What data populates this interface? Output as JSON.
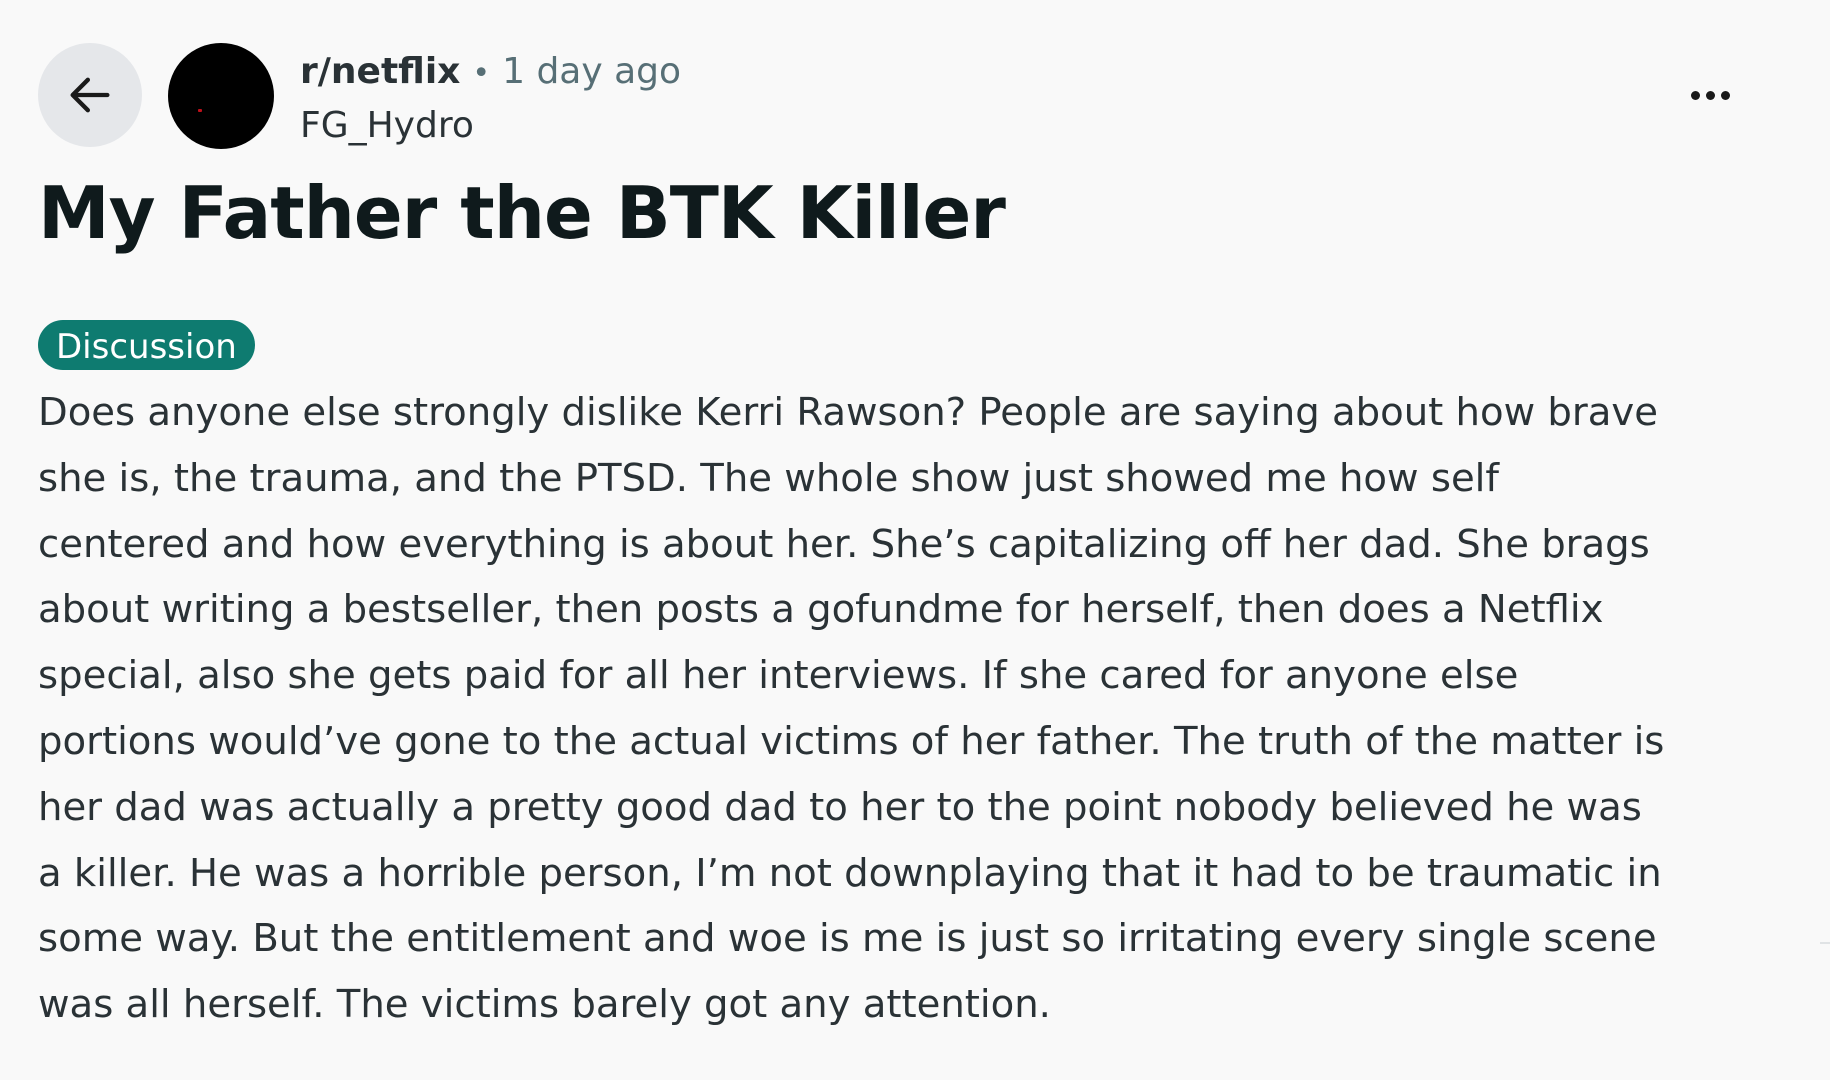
{
  "post": {
    "subreddit": "r/netflix",
    "separator": "•",
    "time": "1 day ago",
    "author": "FG_Hydro",
    "title": "My Father the BTK Killer",
    "flair": "Discussion",
    "body_lines": [
      "Does anyone else strongly dislike Kerri Rawson? People are saying about how brave",
      "she is, the trauma, and the PTSD. The whole show just showed me how self",
      "centered and how everything is about her. She’s capitalizing off her dad. She brags",
      "about writing a bestseller, then posts a gofundme for herself, then does a Netflix",
      "special, also she gets paid for all her interviews. If she cared for anyone else",
      "portions would’ve gone to the actual victims of her father. The truth of the matter is",
      "her dad was actually a pretty good dad to her to the point nobody believed he was",
      "a killer. He was a horrible person, I’m not downplaying that it had to be traumatic in",
      "some way. But the entitlement and woe is me is just so irritating every single scene",
      "was all herself. The victims barely got any attention."
    ]
  },
  "icons": {
    "back": "arrow-left-icon",
    "more": "more-horizontal-icon",
    "avatar": "community-avatar"
  },
  "colors": {
    "background": "#f9f9f9",
    "back_button_bg": "#e5e7ea",
    "flair_bg": "#0e7b70",
    "flair_text": "#ffffff",
    "meta_text": "#576f76"
  }
}
